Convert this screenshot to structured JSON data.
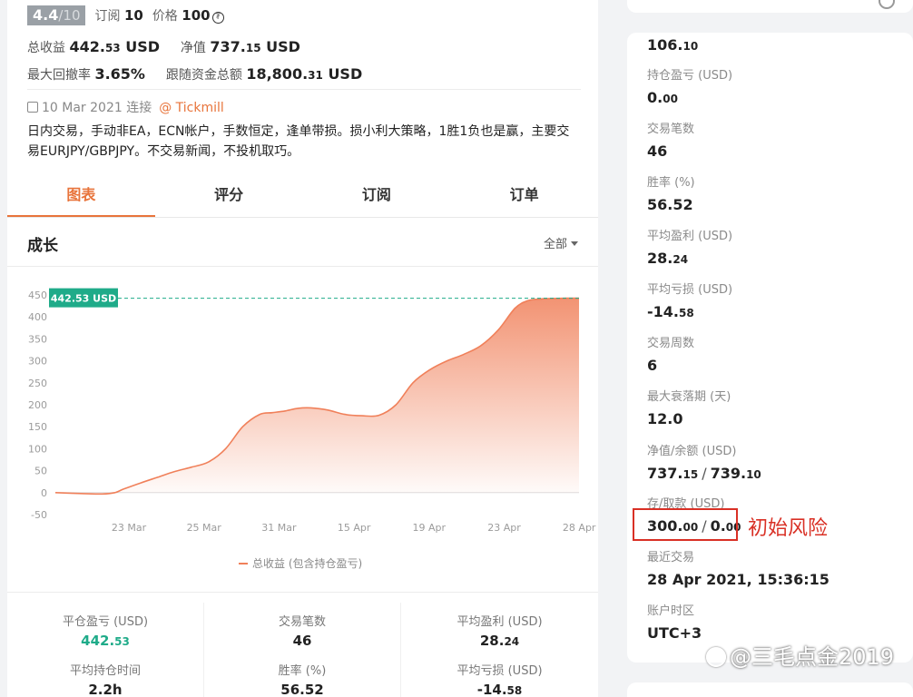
{
  "header": {
    "rating": "4.4",
    "rating_max": "/10",
    "subscriptions_label": "订阅",
    "subscriptions_value": "10",
    "price_label": "价格",
    "price_value": "100",
    "price_currency_symbol": "₮"
  },
  "summary": {
    "total_profit_label": "总收益",
    "total_profit_int": "442.",
    "total_profit_dec": "53",
    "total_profit_unit": "USD",
    "net_value_label": "净值",
    "net_value_int": "737.",
    "net_value_dec": "15",
    "net_value_unit": "USD",
    "max_drawdown_label": "最大回撤率",
    "max_drawdown_value": "3.65%",
    "follow_funds_label": "跟随资金总额",
    "follow_funds_int": "18,800.",
    "follow_funds_dec": "31",
    "follow_funds_unit": "USD"
  },
  "strategy": {
    "since_date": "10 Mar 2021",
    "since_label": "连接",
    "broker": "@ Tickmill",
    "description": "日内交易，手动非EA，ECN帐户，手数恒定，逢单带损。损小利大策略，1胜1负也是赢，主要交易EURJPY/GBPJPY。不交易新闻，不投机取巧。"
  },
  "tabs": [
    {
      "label": "图表",
      "active": true
    },
    {
      "label": "评分",
      "active": false
    },
    {
      "label": "订阅",
      "active": false
    },
    {
      "label": "订单",
      "active": false
    }
  ],
  "growth": {
    "title": "成长",
    "range": "全部"
  },
  "chart_data": {
    "type": "area",
    "title": "",
    "xlabel": "",
    "ylabel": "",
    "ylim": [
      -50,
      450
    ],
    "yticks": [
      "450",
      "400",
      "350",
      "300",
      "250",
      "200",
      "150",
      "100",
      "50",
      "0",
      "-50"
    ],
    "xticks": [
      "23 Mar",
      "25 Mar",
      "31 Mar",
      "15 Apr",
      "19 Apr",
      "23 Apr",
      "28 Apr"
    ],
    "current_value_label": "442.53 USD",
    "current_value": 442.53,
    "legend": "总收益 (包含持仓盈亏)",
    "series_color": "#f0805a",
    "marker_color": "#1fab89",
    "x_index": [
      0,
      0.3,
      0.55,
      0.7,
      0.8,
      1.0,
      1.2,
      1.4,
      1.6,
      1.8,
      2.0,
      2.2,
      2.4,
      2.55,
      2.7,
      2.85,
      3.0,
      3.2,
      3.4,
      3.6,
      3.8,
      4.0,
      4.2,
      4.4,
      4.6,
      4.8,
      5.0,
      5.2,
      5.4,
      5.55,
      5.7,
      5.85,
      6.0,
      6.15
    ],
    "values": [
      0,
      -2,
      -3,
      0,
      8,
      22,
      35,
      48,
      58,
      70,
      100,
      150,
      178,
      182,
      186,
      192,
      193,
      188,
      178,
      175,
      176,
      200,
      250,
      280,
      300,
      315,
      335,
      370,
      420,
      437,
      441,
      442,
      442.5,
      442.53
    ]
  },
  "bottom_stats": [
    {
      "label": "平仓盈亏 (USD)",
      "value_int": "442.",
      "value_dec": "53",
      "green": true
    },
    {
      "label": "交易笔数",
      "value_int": "46",
      "value_dec": "",
      "green": false
    },
    {
      "label": "平均盈利 (USD)",
      "value_int": "28.",
      "value_dec": "24",
      "green": false
    },
    {
      "label": "平均持仓时间",
      "value_int": "2.2h",
      "value_dec": "",
      "green": false
    },
    {
      "label": "胜率 (%)",
      "value_int": "56.52",
      "value_dec": "",
      "green": false
    },
    {
      "label": "平均亏损 (USD)",
      "value_int": "-14.",
      "value_dec": "58",
      "green": false
    }
  ],
  "side": {
    "top_value_int": "106.",
    "top_value_dec": "10",
    "items": [
      {
        "label": "持仓盈亏 (USD)",
        "value_int": "0.",
        "value_dec": "00"
      },
      {
        "label": "交易笔数",
        "value_int": "46",
        "value_dec": ""
      },
      {
        "label": "胜率 (%)",
        "value_int": "56.52",
        "value_dec": ""
      },
      {
        "label": "平均盈利 (USD)",
        "value_int": "28.",
        "value_dec": "24"
      },
      {
        "label": "平均亏损 (USD)",
        "value_int": "-14.",
        "value_dec": "58"
      },
      {
        "label": "交易周数",
        "value_int": "6",
        "value_dec": ""
      },
      {
        "label": "最大衰落期 (天)",
        "value_int": "12.0",
        "value_dec": ""
      }
    ],
    "equity_label": "净值/余额 (USD)",
    "equity_a_int": "737.",
    "equity_a_dec": "15",
    "equity_b_int": "739.",
    "equity_b_dec": "10",
    "deposit_label": "存/取款 (USD)",
    "deposit_a_int": "300.",
    "deposit_a_dec": "00",
    "deposit_b_int": "0.",
    "deposit_b_dec": "00",
    "last_trade_label": "最近交易",
    "last_trade_value": "28 Apr 2021, 15:36:15",
    "timezone_label": "账户时区",
    "timezone_value": "UTC+3"
  },
  "annotation": {
    "risk_note": "初始风险",
    "highlight_color": "#d93025"
  },
  "watermark": {
    "text": "@三毛点金2019"
  }
}
